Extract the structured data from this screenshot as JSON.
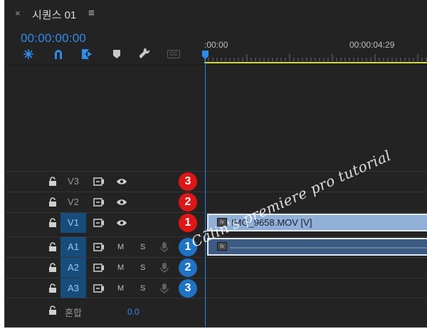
{
  "window": {
    "close_icon": "×",
    "title": "시퀀스 01",
    "menu_icon": "≡"
  },
  "timecode": "00:00:00:00",
  "toolbar": {
    "tools": [
      "snap-icon",
      "linked-selection-icon",
      "add-marker-icon",
      "marker-icon",
      "wrench-icon",
      "captions-icon"
    ],
    "captions_label": "CC"
  },
  "ruler": {
    "start_label": ":00:00",
    "end_label": "00:00:04:29"
  },
  "tracks": {
    "video": [
      {
        "name": "V3",
        "active": false,
        "annotation": "3"
      },
      {
        "name": "V2",
        "active": false,
        "annotation": "2"
      },
      {
        "name": "V1",
        "active": true,
        "annotation": "1"
      }
    ],
    "audio": [
      {
        "name": "A1",
        "active": true,
        "mute": "M",
        "solo": "S",
        "annotation": "1"
      },
      {
        "name": "A2",
        "active": true,
        "mute": "M",
        "solo": "S",
        "annotation": "2"
      },
      {
        "name": "A3",
        "active": true,
        "mute": "M",
        "solo": "S",
        "annotation": "3"
      }
    ],
    "mix": {
      "label": "혼합",
      "value": "0.0"
    }
  },
  "clips": {
    "video": {
      "name": "IMG_9658.MOV [V]",
      "fx": "fx"
    },
    "audio": {
      "fx": "fx"
    }
  },
  "watermark": "Cãlin's premiere pro tutorial",
  "colors": {
    "accent": "#2d8ceb",
    "active_track": "#174d7d",
    "video_clip": "#90b0d8",
    "audio_clip": "#3c5b82",
    "annotation_red": "#e01515",
    "annotation_blue": "#1f73c6",
    "work_area": "#d7d74a"
  }
}
